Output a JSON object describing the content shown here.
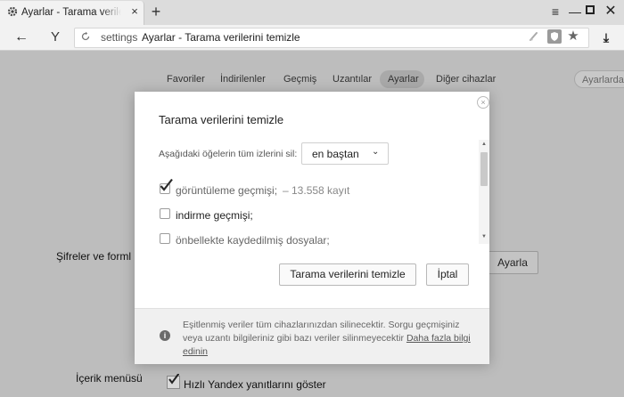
{
  "tab": {
    "title": "Ayarlar - Tarama verilerini temizle"
  },
  "toolbar": {
    "url_host": "settings",
    "url_title": "Ayarlar - Tarama verilerini temizle"
  },
  "settings_nav": {
    "items": [
      "Favoriler",
      "İndirilenler",
      "Geçmiş",
      "Uzantılar",
      "Ayarlar",
      "Diğer cihazlar"
    ],
    "active": "Ayarlar",
    "search_placeholder": "Ayarlarda"
  },
  "settings_page": {
    "passwords_label": "Şifreler ve forml",
    "configure_button": "Ayarla",
    "context_menu_label": "İçerik menüsü",
    "fast_answers_label": "Hızlı Yandex yanıtlarını göster",
    "fast_answers_checked": true
  },
  "dialog": {
    "title": "Tarama verilerini temizle",
    "range_label": "Aşağıdaki öğelerin tüm izlerini sil:",
    "range_value": "en baştan",
    "options": [
      {
        "label": "görüntüleme geçmişi;",
        "detail": "–  13.558 kayıt",
        "checked": true
      },
      {
        "label": "indirme geçmişi;",
        "detail": "",
        "checked": false
      },
      {
        "label": "önbellekte kaydedilmiş dosyalar;",
        "detail": "",
        "checked": false
      }
    ],
    "clear_button": "Tarama verilerini temizle",
    "cancel_button": "İptal",
    "footer_text": "Eşitlenmiş veriler tüm cihazlarınızdan silinecektir. Sorgu geçmişiniz veya uzantı bilgileriniz gibi bazı veriler silinmeyecektir ",
    "footer_link": "Daha fazla bilgi edinin"
  }
}
